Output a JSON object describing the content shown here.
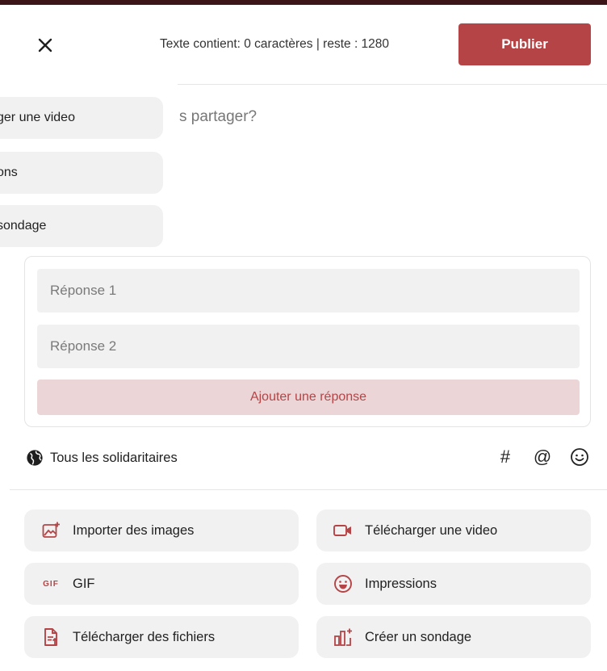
{
  "header": {
    "counter_text": "Texte contient: 0 caractères | reste : 1280",
    "publish_label": "Publier"
  },
  "composer": {
    "placeholder_visible": "s partager?"
  },
  "floating_menu": {
    "items": [
      {
        "label": "ger une video"
      },
      {
        "label": "ons"
      },
      {
        "label": "sondage"
      }
    ]
  },
  "poll": {
    "answers": [
      {
        "placeholder": "Réponse 1"
      },
      {
        "placeholder": "Réponse 2"
      }
    ],
    "add_answer_label": "Ajouter une réponse"
  },
  "audience": {
    "label": "Tous les solidaritaires",
    "icon": "globe-icon"
  },
  "tools": [
    {
      "icon": "hashtag-icon",
      "glyph": "#"
    },
    {
      "icon": "mention-icon",
      "glyph": "@"
    },
    {
      "icon": "emoji-icon",
      "glyph": "☺"
    }
  ],
  "actions": [
    {
      "label": "Importer des images",
      "icon": "image-add-icon"
    },
    {
      "label": "Télécharger une video",
      "icon": "video-icon"
    },
    {
      "label": "GIF",
      "icon": "gif-icon",
      "icon_text": "GIF"
    },
    {
      "label": "Impressions",
      "icon": "emoji-face-icon"
    },
    {
      "label": "Télécharger des fichiers",
      "icon": "file-upload-icon"
    },
    {
      "label": "Créer un sondage",
      "icon": "poll-icon"
    }
  ],
  "colors": {
    "accent": "#b54447",
    "accent_light": "#ecd5d6",
    "field_bg": "#f1f1f1"
  }
}
